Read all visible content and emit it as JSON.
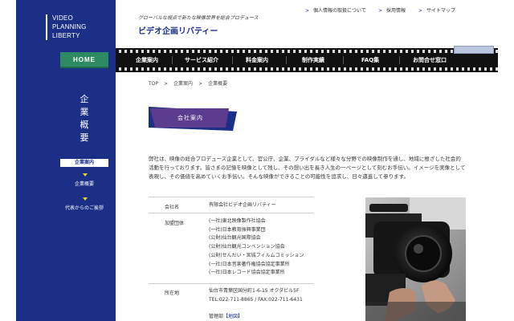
{
  "logo": {
    "lines": [
      "VIDEO",
      "PLANNING",
      "LIBERTY"
    ]
  },
  "sidebar": {
    "home": "HOME",
    "title_chars": [
      "企",
      "業",
      "概",
      "要"
    ],
    "nav": [
      {
        "label": "企業案内",
        "active": true
      },
      {
        "label": "企業概要",
        "active": false
      },
      {
        "label": "代表からのご挨拶",
        "active": false
      }
    ]
  },
  "header": {
    "tagline": "グローバルな視点で新たな映像世界を総合プロデュース",
    "site_title": "ビデオ企画リバティー",
    "util_links": [
      "個人情報の取扱について",
      "採用情報",
      "サイトマップ"
    ]
  },
  "gnav": [
    "企業案内",
    "サービス紹介",
    "料金案内",
    "制作実績",
    "FAQ集",
    "お問合せ窓口"
  ],
  "breadcrumb": [
    "TOP",
    "企業案内",
    "企業概要"
  ],
  "section_heading": "会社案内",
  "intro": [
    "弊社は、映像の総合プロデュース企業として、官公庁、企業、ブライダルなど様々な分野での映像制作を通し、地域に根ざした社会的",
    "活動を行っております。皆さまの記憶を映像として残し、その想い出を長き人生の一ページとして刻むお手伝い。イメージを実像として",
    "表現し、その価値を高めていくお手伝い。そんな映像ができることの可能性を追求し、日々邁進して参ります。"
  ],
  "info_table": {
    "company": {
      "label": "会社名",
      "value": "有限会社ビデオ企画リバティー"
    },
    "memberships": {
      "label": "加盟団体",
      "values": [
        "(一社)東北映像製作社協会",
        "(一社)日本教育振興事業団",
        "(公財)仙台観光国際協会",
        "(公財)仙台観光コンベンション協会",
        "(公財)せんだい・宮城フィルムコミッション",
        "(一社)日本音楽著作権協会協定事業所",
        "(一社)日本レコード協会協定事業所"
      ]
    },
    "address": {
      "label": "所在地",
      "lines": [
        "仙台市青葉区国分町1-6-15 オクダビル5F",
        "TEL:022-711-8865 / FAX:022-711-6431"
      ],
      "management_prefix": "管理部",
      "map_link": "【地図】"
    }
  },
  "colors": {
    "navy": "#1b2f86",
    "green": "#2d8a63",
    "ribbon": "#5b3c8f",
    "accent": "#e8d42a"
  }
}
